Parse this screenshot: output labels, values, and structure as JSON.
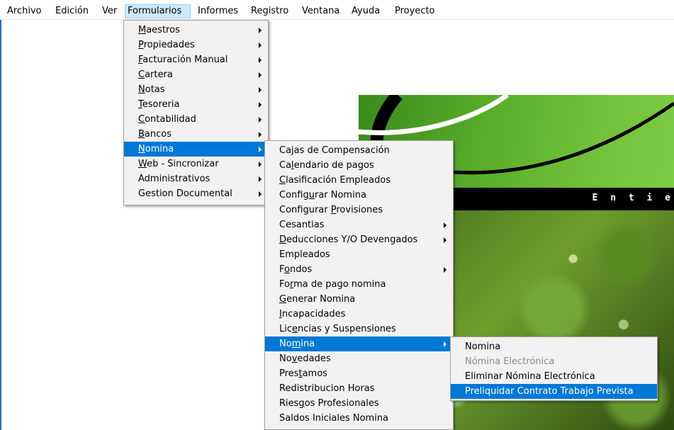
{
  "menubar": {
    "archivo": "Archivo",
    "edicion": "Edición",
    "ver": "Ver",
    "formularios": "Formularios",
    "informes": "Informes",
    "registro": "Registro",
    "ventana": "Ventana",
    "ayuda": "Ayuda",
    "proyecto": "Proyecto"
  },
  "banner": {
    "band_text": "E n t i e"
  },
  "formularios_menu": {
    "maestros": {
      "u": "M",
      "rest": "aestros"
    },
    "propiedades": {
      "u": "P",
      "rest": "ropiedades"
    },
    "facturacion": {
      "u": "F",
      "rest": "acturación Manual"
    },
    "cartera": {
      "u": "C",
      "rest": "artera"
    },
    "notas": {
      "u": "N",
      "rest": "otas"
    },
    "tesoreria": {
      "u": "T",
      "rest": "esoreria"
    },
    "contabilidad": {
      "u": "C",
      "rest": "ontabilidad"
    },
    "bancos": {
      "u": "B",
      "rest": "ancos"
    },
    "nomina": {
      "u": "N",
      "rest": "omina"
    },
    "web": {
      "u": "W",
      "rest": "eb - Sincronizar"
    },
    "administrativos": {
      "label": "Administrativos"
    },
    "gestion": {
      "label": "Gestion Documental"
    }
  },
  "nomina_menu": {
    "cajas": {
      "label": "Cajas de Compensación"
    },
    "calendario": {
      "pre": "Ca",
      "u": "l",
      "rest": "endario de pagos"
    },
    "clasificacion": {
      "u": "C",
      "rest": "lasificación Empleados"
    },
    "configurar_nomina": {
      "pre": "Config",
      "u": "u",
      "rest": "rar Nomina"
    },
    "configurar_provisiones": {
      "pre": "Configurar ",
      "u": "P",
      "rest": "rovisiones"
    },
    "cesantias": {
      "label": "Cesantias"
    },
    "deducciones": {
      "u": "D",
      "rest": "educciones Y/O Devengados"
    },
    "empleados": {
      "label": "Empleados"
    },
    "fondos": {
      "pre": "F",
      "u": "o",
      "rest": "ndos"
    },
    "forma_pago": {
      "pre": "Fo",
      "u": "r",
      "rest": "ma de pago nomina"
    },
    "generar": {
      "u": "G",
      "rest": "enerar Nomina"
    },
    "incapacidades": {
      "u": "I",
      "rest": "ncapacidades"
    },
    "licencias": {
      "pre": "Lic",
      "u": "e",
      "rest": "ncias y Suspensiones"
    },
    "nomina": {
      "pre": "No",
      "u": "m",
      "rest": "ina"
    },
    "novedades": {
      "pre": "No",
      "u": "v",
      "rest": "edades"
    },
    "prestamos": {
      "pre": "Pres",
      "u": "t",
      "rest": "amos"
    },
    "redistribucion": {
      "label": "Redistribucion Horas"
    },
    "riesgos": {
      "pre": "Ries",
      "u": "g",
      "rest": "os Profesionales"
    },
    "saldos": {
      "label": "Saldos Iniciales Nomina"
    }
  },
  "nomina_sub_menu": {
    "nomina": "Nomina",
    "nomina_electronica": "Nómina Electrónica",
    "eliminar": "Eliminar Nómina Electrónica",
    "preliquidar": "Preliquidar Contrato Trabajo Prevista"
  }
}
